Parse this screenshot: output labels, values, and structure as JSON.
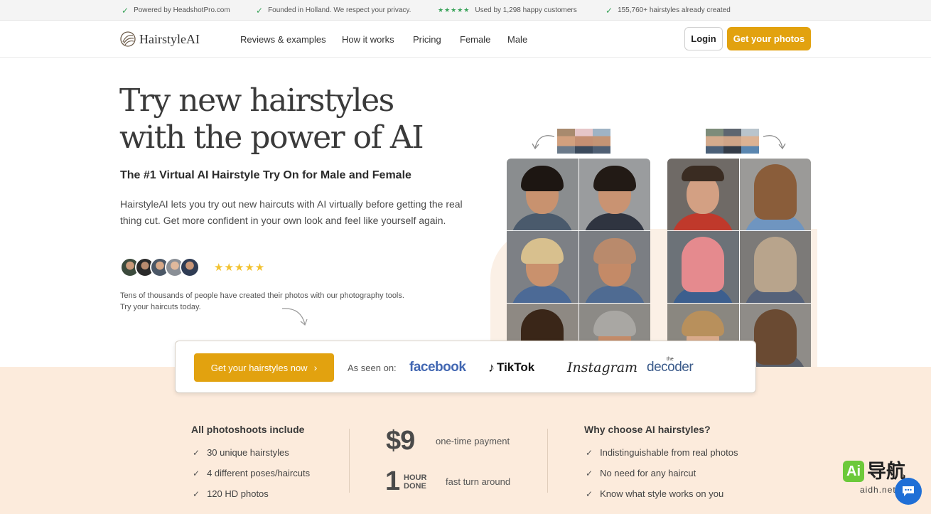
{
  "topbar": {
    "items": [
      {
        "text": "Powered by HeadshotPro.com"
      },
      {
        "text": "Founded in Holland. We respect your privacy."
      },
      {
        "stars": "★★★★★",
        "text": "Used by 1,298 happy customers"
      },
      {
        "text": "155,760+ hairstyles already created"
      }
    ]
  },
  "header": {
    "logo_text": "HairstyleAI",
    "nav": [
      "Reviews & examples",
      "How it works",
      "Pricing",
      "Female",
      "Male"
    ],
    "login_label": "Login",
    "cta_label": "Get your photos"
  },
  "hero": {
    "title_line1": "Try new hairstyles",
    "title_line2": "with the power of AI",
    "subtitle": "The #1 Virtual AI Hairstyle Try On for Male and Female",
    "description": "HairstyleAI lets you try out new haircuts with AI virtually before getting the real thing cut. Get more confident in your own look and feel like yourself again.",
    "stars": "★★★★★",
    "note": "Tens of thousands of people have created their photos with our photography tools. Try your haircuts today."
  },
  "cta_card": {
    "button_label": "Get your hairstyles now",
    "button_chevron": "›",
    "seen_on_label": "As seen on:",
    "brands": [
      "facebook",
      "TikTok",
      "Instagram",
      "decoder"
    ],
    "decoder_prefix": "the"
  },
  "features": {
    "left_title": "All photoshoots include",
    "left_items": [
      "30 unique hairstyles",
      "4 different poses/haircuts",
      "120 HD photos"
    ],
    "price": "$9",
    "price_note": "one-time payment",
    "hour_number": "1",
    "hour_line1": "HOUR",
    "hour_line2": "DONE",
    "turn_note": "fast turn around",
    "right_title": "Why choose AI hairstyles?",
    "right_items": [
      "Indistinguishable from real photos",
      "No need for any haircut",
      "Know what style works on you"
    ]
  },
  "watermark": {
    "ai": "Ai",
    "cn": "导航",
    "url": "aidh.net"
  },
  "colors": {
    "accent": "#e2a20f",
    "beige": "#fcebdc",
    "check_green": "#3aa35a",
    "star_yellow": "#f2c230"
  }
}
